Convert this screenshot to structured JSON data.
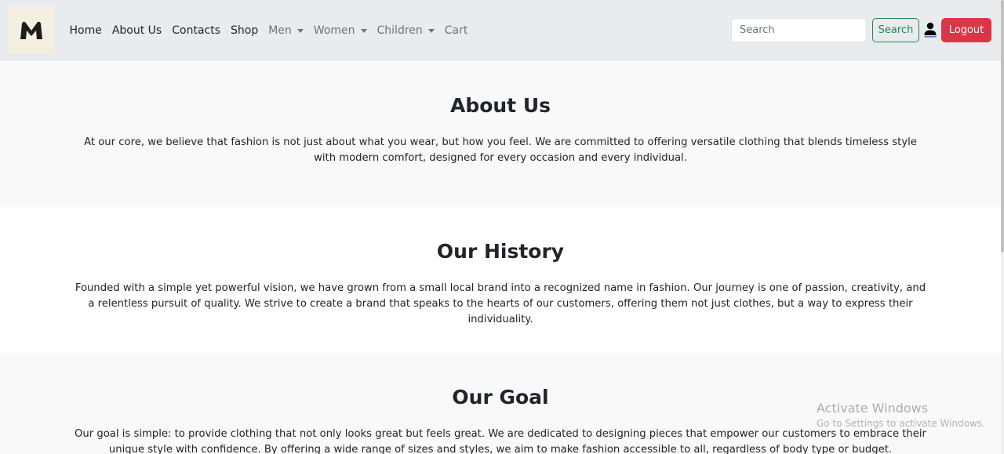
{
  "navbar": {
    "logo_letter": "M",
    "links": [
      {
        "label": "Home",
        "style": "dark"
      },
      {
        "label": "About Us",
        "style": "dark"
      },
      {
        "label": "Contacts",
        "style": "dark"
      },
      {
        "label": "Shop",
        "style": "dark"
      },
      {
        "label": "Men",
        "style": "muted",
        "dropdown": true
      },
      {
        "label": "Women",
        "style": "muted",
        "dropdown": true
      },
      {
        "label": "Children",
        "style": "muted",
        "dropdown": true
      },
      {
        "label": "Cart",
        "style": "muted"
      }
    ],
    "search_placeholder": "Search",
    "search_button": "Search",
    "user_icon": "user-icon",
    "logout_button": "Logout"
  },
  "sections": {
    "about": {
      "title": "About Us",
      "text": "At our core, we believe that fashion is not just about what you wear, but how you feel. We are committed to offering versatile clothing that blends timeless style with modern comfort, designed for every occasion and every individual."
    },
    "history": {
      "title": "Our History",
      "text": "Founded with a simple yet powerful vision, we have grown from a small local brand into a recognized name in fashion. Our journey is one of passion, creativity, and a relentless pursuit of quality. We strive to create a brand that speaks to the hearts of our customers, offering them not just clothes, but a way to express their individuality."
    },
    "goal": {
      "title": "Our Goal",
      "text": "Our goal is simple: to provide clothing that not only looks great but feels great. We are dedicated to designing pieces that empower our customers to embrace their unique style with confidence. By offering a wide range of sizes and styles, we aim to make fashion accessible to all, regardless of body type or budget."
    }
  },
  "watermark": {
    "title": "Activate Windows",
    "subtitle": "Go to Settings to activate Windows."
  },
  "colors": {
    "navbar_bg": "#e9ecef",
    "section_gray": "#f8f9fa",
    "search_green": "#198754",
    "logout_red": "#dc3545"
  }
}
